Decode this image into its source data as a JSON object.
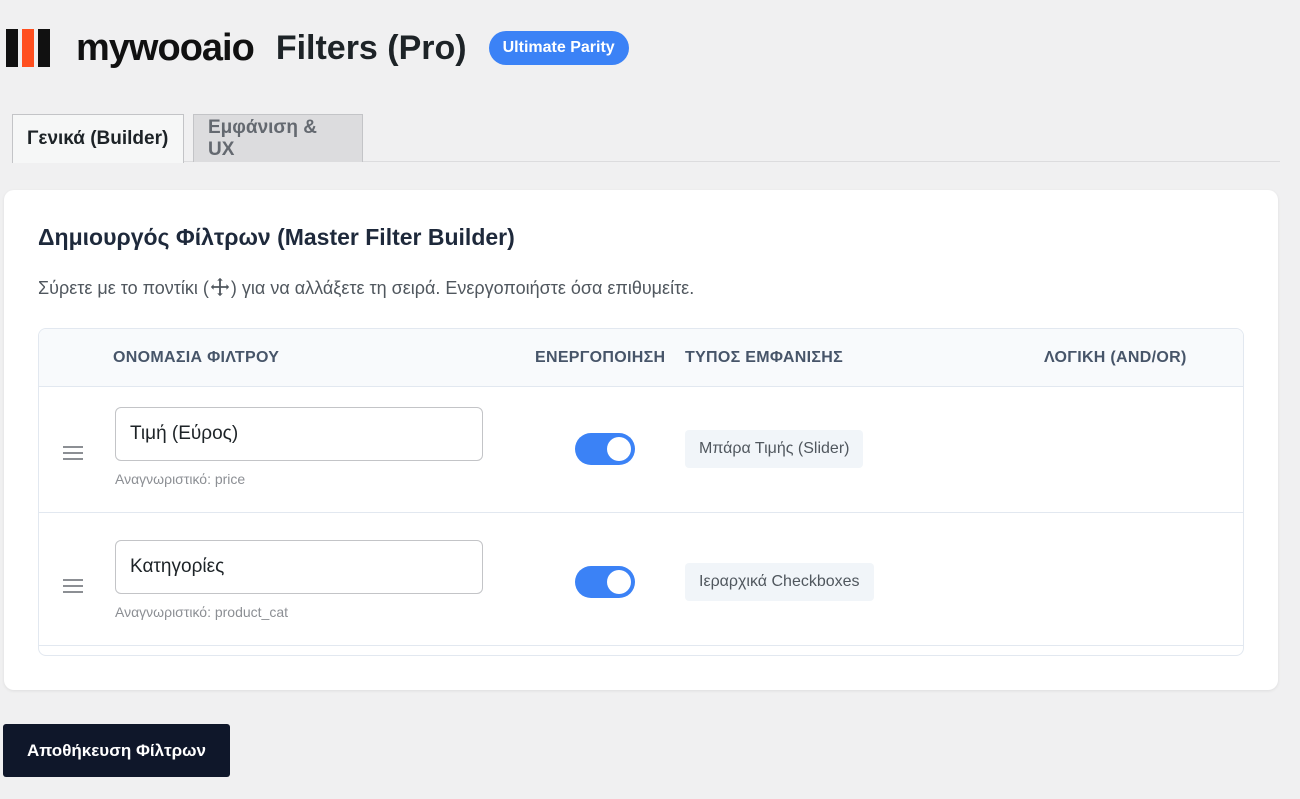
{
  "header": {
    "brand": "mywooaio",
    "title": "Filters (Pro)",
    "badge": "Ultimate Parity"
  },
  "tabs": [
    {
      "label": "Γενικά (Builder)",
      "active": true
    },
    {
      "label": "Εμφάνιση & UX",
      "active": false
    }
  ],
  "builder": {
    "title": "Δημιουργός Φίλτρων (Master Filter Builder)",
    "description_pre": "Σύρετε με το ποντίκι (",
    "description_icon": "move-arrows-icon",
    "description_post": ") για να αλλάξετε τη σειρά. Ενεργοποιήστε όσα επιθυμείτε."
  },
  "table": {
    "columns": [
      "ΟΝΟΜΑΣΙΑ ΦΙΛΤΡΟΥ",
      "ΕΝΕΡΓΟΠΟΙΗΣΗ",
      "ΤΥΠΟΣ ΕΜΦΑΝΙΣΗΣ",
      "ΛΟΓΙΚΗ (AND/OR)"
    ],
    "rows": [
      {
        "name": "Τιμή (Εύρος)",
        "identifier": "Αναγνωριστικό: price",
        "enabled": true,
        "display_type": "Μπάρα Τιμής (Slider)",
        "logic": ""
      },
      {
        "name": "Κατηγορίες",
        "identifier": "Αναγνωριστικό: product_cat",
        "enabled": true,
        "display_type": "Ιεραρχικά Checkboxes",
        "logic": ""
      }
    ]
  },
  "save_label": "Αποθήκευση Φίλτρων",
  "colors": {
    "accent": "#3b82f6",
    "logo_orange": "#ff4f1f",
    "dark": "#0f172a"
  }
}
